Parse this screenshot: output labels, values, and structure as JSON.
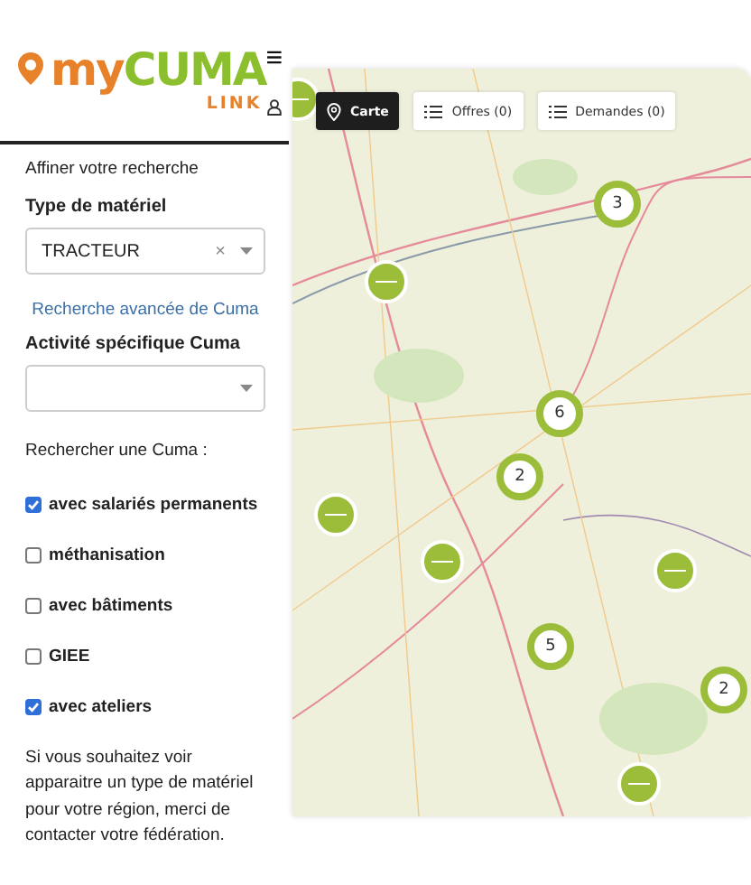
{
  "logo": {
    "brand_prefix": "my",
    "brand_main": "CUMA",
    "brand_sub": "LINK"
  },
  "menu_icon": "≡",
  "search": {
    "heading": "Affiner votre recherche",
    "equipment": {
      "label": "Type de matériel",
      "value": "TRACTEUR",
      "clear": "×"
    },
    "advanced_link": "Recherche avancée de Cuma",
    "activity": {
      "label": "Activité spécifique Cuma"
    },
    "filters_label": "Rechercher une Cuma :",
    "filters": [
      {
        "label": "avec salariés permanents",
        "checked": true
      },
      {
        "label": "méthanisation",
        "checked": false
      },
      {
        "label": "avec bâtiments",
        "checked": false
      },
      {
        "label": "GIEE",
        "checked": false
      },
      {
        "label": "avec ateliers",
        "checked": true
      }
    ],
    "note": "Si vous souhaitez voir apparaitre un type de matériel pour votre région, merci de contacter votre fédération."
  },
  "map": {
    "tabs": [
      {
        "label": "Carte",
        "kind": "map",
        "selected": true
      },
      {
        "label": "Offres (0)",
        "kind": "list",
        "selected": false
      },
      {
        "label": "Demandes (0)",
        "kind": "list",
        "selected": false
      }
    ],
    "markers": [
      {
        "kind": "single"
      },
      {
        "kind": "cluster",
        "count": "3"
      },
      {
        "kind": "single"
      },
      {
        "kind": "cluster",
        "count": "6"
      },
      {
        "kind": "cluster",
        "count": "2"
      },
      {
        "kind": "single"
      },
      {
        "kind": "single"
      },
      {
        "kind": "single"
      },
      {
        "kind": "cluster",
        "count": "5"
      },
      {
        "kind": "cluster",
        "count": "2"
      },
      {
        "kind": "single"
      }
    ]
  }
}
